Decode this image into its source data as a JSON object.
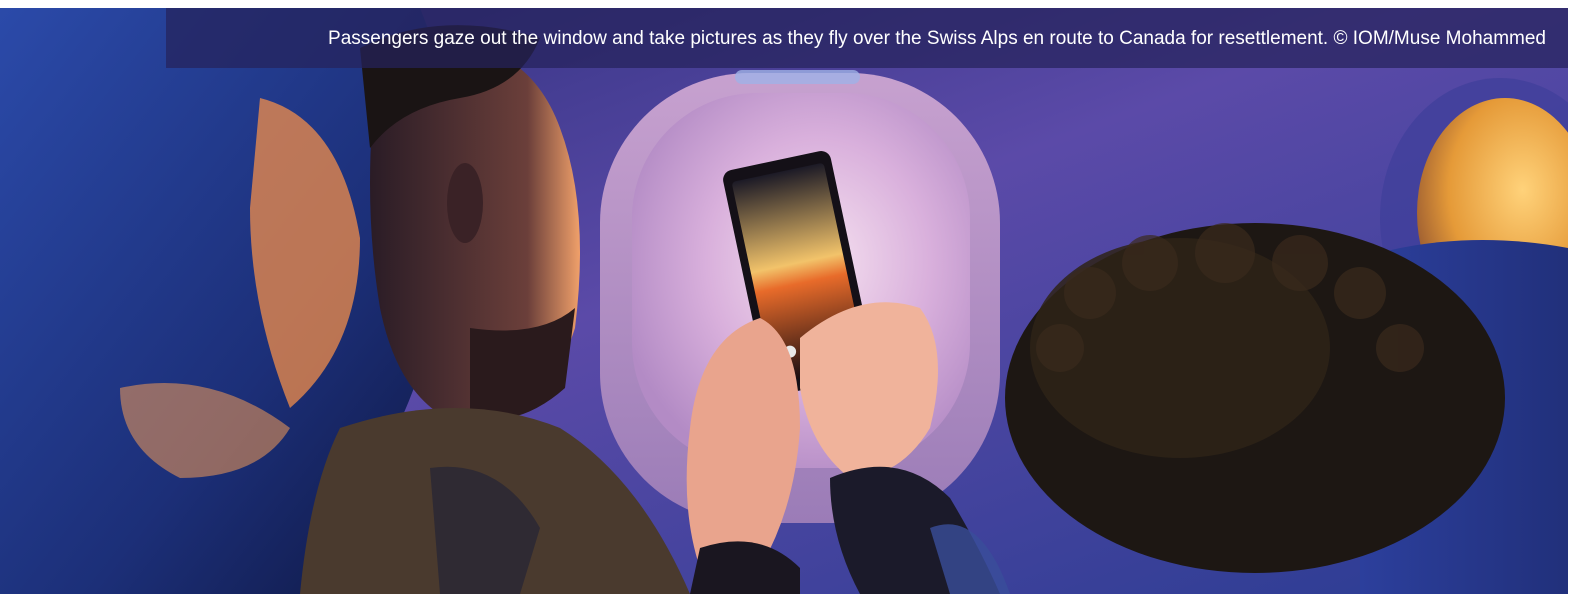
{
  "hero": {
    "caption": "Passengers gaze out the window and take pictures as they fly over the Swiss Alps en route to Canada for resettlement.  © IOM/Muse Mohammed"
  },
  "colors": {
    "cabin_blue": "#3a3b9a",
    "window_glow": "#f3e6f2",
    "sunset_orange": "#f19a3a",
    "phone_dark": "#151015",
    "caption_band": "#26225c"
  }
}
